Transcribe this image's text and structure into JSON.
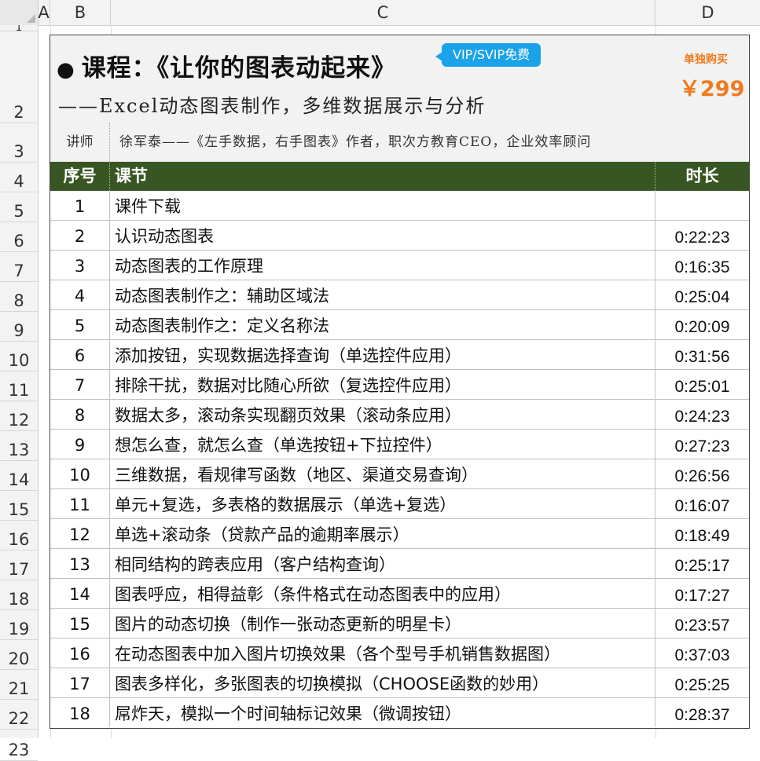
{
  "columns": [
    "A",
    "B",
    "C",
    "D"
  ],
  "row_numbers": [
    "1",
    "2",
    "3",
    "4",
    "5",
    "6",
    "7",
    "8",
    "9",
    "10",
    "11",
    "12",
    "13",
    "14",
    "15",
    "16",
    "17",
    "18",
    "19",
    "20",
    "21",
    "22",
    "23"
  ],
  "header": {
    "bullet": "●",
    "course_title": "课程：《让你的图表动起来》",
    "badge": "VIP/SVIP免费",
    "subtitle": "——Excel动态图表制作，多维数据展示与分析",
    "buy_label": "单独购买",
    "price": "￥299",
    "accent_color": "#f07a1e",
    "badge_color": "#1aa3e8"
  },
  "lecturer": {
    "label": "讲师",
    "text": "徐军泰——《左手数据，右手图表》作者，职次方教育CEO，企业效率顾问"
  },
  "table": {
    "header_color": "#375623",
    "col_no": "序号",
    "col_title": "课节",
    "col_duration": "时长",
    "rows": [
      {
        "no": "1",
        "title": "课件下载",
        "duration": ""
      },
      {
        "no": "2",
        "title": "认识动态图表",
        "duration": "0:22:23"
      },
      {
        "no": "3",
        "title": "动态图表的工作原理",
        "duration": "0:16:35"
      },
      {
        "no": "4",
        "title": "动态图表制作之：辅助区域法",
        "duration": "0:25:04"
      },
      {
        "no": "5",
        "title": "动态图表制作之：定义名称法",
        "duration": "0:20:09"
      },
      {
        "no": "6",
        "title": "添加按钮，实现数据选择查询（单选控件应用）",
        "duration": "0:31:56"
      },
      {
        "no": "7",
        "title": "排除干扰，数据对比随心所欲（复选控件应用）",
        "duration": "0:25:01"
      },
      {
        "no": "8",
        "title": "数据太多，滚动条实现翻页效果（滚动条应用）",
        "duration": "0:24:23"
      },
      {
        "no": "9",
        "title": "想怎么查，就怎么查（单选按钮+下拉控件）",
        "duration": "0:27:23"
      },
      {
        "no": "10",
        "title": "三维数据，看规律写函数（地区、渠道交易查询）",
        "duration": "0:26:56"
      },
      {
        "no": "11",
        "title": "单元+复选，多表格的数据展示（单选+复选）",
        "duration": "0:16:07"
      },
      {
        "no": "12",
        "title": "单选+滚动条（贷款产品的逾期率展示）",
        "duration": "0:18:49"
      },
      {
        "no": "13",
        "title": "相同结构的跨表应用（客户结构查询）",
        "duration": "0:25:17"
      },
      {
        "no": "14",
        "title": "图表呼应，相得益彰（条件格式在动态图表中的应用）",
        "duration": "0:17:27"
      },
      {
        "no": "15",
        "title": "图片的动态切换（制作一张动态更新的明星卡）",
        "duration": "0:23:57"
      },
      {
        "no": "16",
        "title": "在动态图表中加入图片切换效果（各个型号手机销售数据图）",
        "duration": "0:37:03"
      },
      {
        "no": "17",
        "title": "图表多样化，多张图表的切换模拟（CHOOSE函数的妙用）",
        "duration": "0:25:25"
      },
      {
        "no": "18",
        "title": "屌炸天，模拟一个时间轴标记效果（微调按钮）",
        "duration": "0:28:37"
      }
    ]
  }
}
